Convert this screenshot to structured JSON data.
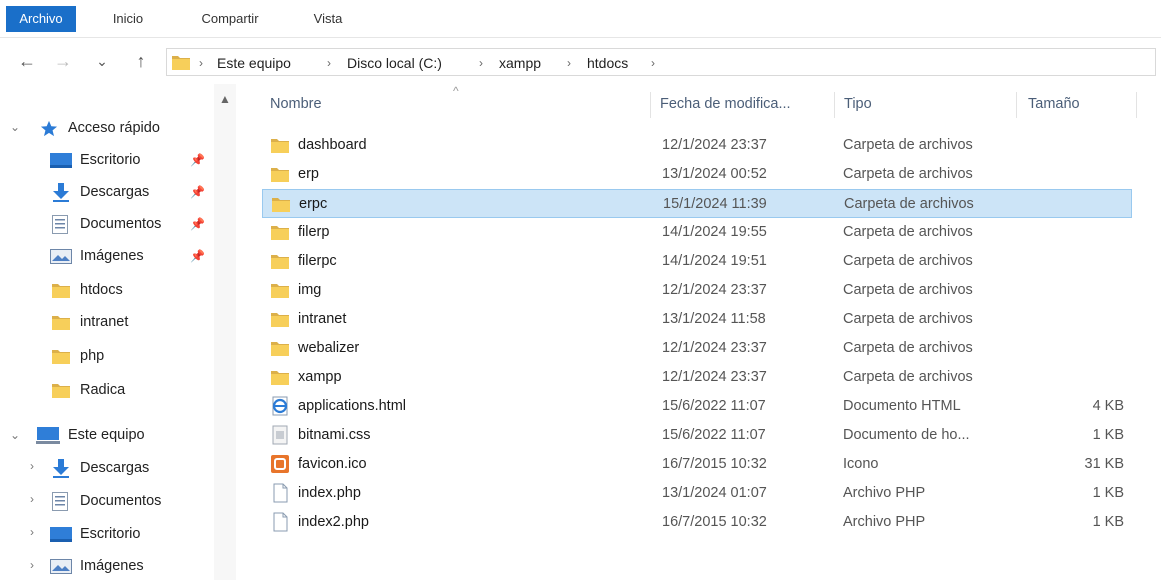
{
  "ribbon": {
    "tabs": [
      "Archivo",
      "Inicio",
      "Compartir",
      "Vista"
    ]
  },
  "nav": {
    "back": "←",
    "forward": "→",
    "recent": "⌄",
    "up": "↑"
  },
  "address": {
    "crumbs": [
      "Este equipo",
      "Disco local (C:)",
      "xampp",
      "htdocs"
    ],
    "separator": "›"
  },
  "sidebar": {
    "quick_access": "Acceso rápido",
    "quick_items": [
      {
        "label": "Escritorio",
        "icon": "desktop-icon",
        "pinned": true
      },
      {
        "label": "Descargas",
        "icon": "download-icon",
        "pinned": true
      },
      {
        "label": "Documentos",
        "icon": "documents-icon",
        "pinned": true
      },
      {
        "label": "Imágenes",
        "icon": "pictures-icon",
        "pinned": true
      },
      {
        "label": "htdocs",
        "icon": "folder-icon",
        "pinned": false
      },
      {
        "label": "intranet",
        "icon": "folder-icon",
        "pinned": false
      },
      {
        "label": "php",
        "icon": "folder-icon",
        "pinned": false
      },
      {
        "label": "Radica",
        "icon": "folder-icon",
        "pinned": false
      }
    ],
    "this_pc": "Este equipo",
    "pc_items": [
      {
        "label": "Descargas",
        "icon": "download-icon"
      },
      {
        "label": "Documentos",
        "icon": "documents-icon"
      },
      {
        "label": "Escritorio",
        "icon": "desktop-icon"
      },
      {
        "label": "Imágenes",
        "icon": "pictures-icon"
      }
    ]
  },
  "columns": {
    "name": "Nombre",
    "date": "Fecha de modifica...",
    "type": "Tipo",
    "size": "Tamaño"
  },
  "files": [
    {
      "name": "dashboard",
      "date": "12/1/2024 23:37",
      "type": "Carpeta de archivos",
      "size": "",
      "icon": "folder-icon"
    },
    {
      "name": "erp",
      "date": "13/1/2024 00:52",
      "type": "Carpeta de archivos",
      "size": "",
      "icon": "folder-icon"
    },
    {
      "name": "erpc",
      "date": "15/1/2024 11:39",
      "type": "Carpeta de archivos",
      "size": "",
      "icon": "folder-icon",
      "selected": true
    },
    {
      "name": "filerp",
      "date": "14/1/2024 19:55",
      "type": "Carpeta de archivos",
      "size": "",
      "icon": "folder-icon"
    },
    {
      "name": "filerpc",
      "date": "14/1/2024 19:51",
      "type": "Carpeta de archivos",
      "size": "",
      "icon": "folder-icon"
    },
    {
      "name": "img",
      "date": "12/1/2024 23:37",
      "type": "Carpeta de archivos",
      "size": "",
      "icon": "folder-icon"
    },
    {
      "name": "intranet",
      "date": "13/1/2024 11:58",
      "type": "Carpeta de archivos",
      "size": "",
      "icon": "folder-icon"
    },
    {
      "name": "webalizer",
      "date": "12/1/2024 23:37",
      "type": "Carpeta de archivos",
      "size": "",
      "icon": "folder-icon"
    },
    {
      "name": "xampp",
      "date": "12/1/2024 23:37",
      "type": "Carpeta de archivos",
      "size": "",
      "icon": "folder-icon"
    },
    {
      "name": "applications.html",
      "date": "15/6/2022 11:07",
      "type": "Documento HTML",
      "size": "4 KB",
      "icon": "html-file-icon"
    },
    {
      "name": "bitnami.css",
      "date": "15/6/2022 11:07",
      "type": "Documento de ho...",
      "size": "1 KB",
      "icon": "css-file-icon"
    },
    {
      "name": "favicon.ico",
      "date": "16/7/2015 10:32",
      "type": "Icono",
      "size": "31 KB",
      "icon": "ico-file-icon"
    },
    {
      "name": "index.php",
      "date": "13/1/2024 01:07",
      "type": "Archivo PHP",
      "size": "1 KB",
      "icon": "file-icon"
    },
    {
      "name": "index2.php",
      "date": "16/7/2015 10:32",
      "type": "Archivo PHP",
      "size": "1 KB",
      "icon": "file-icon"
    }
  ],
  "colors": {
    "accent": "#1a6fc9",
    "selection": "#cce4f7",
    "folder": "#f5c342"
  }
}
